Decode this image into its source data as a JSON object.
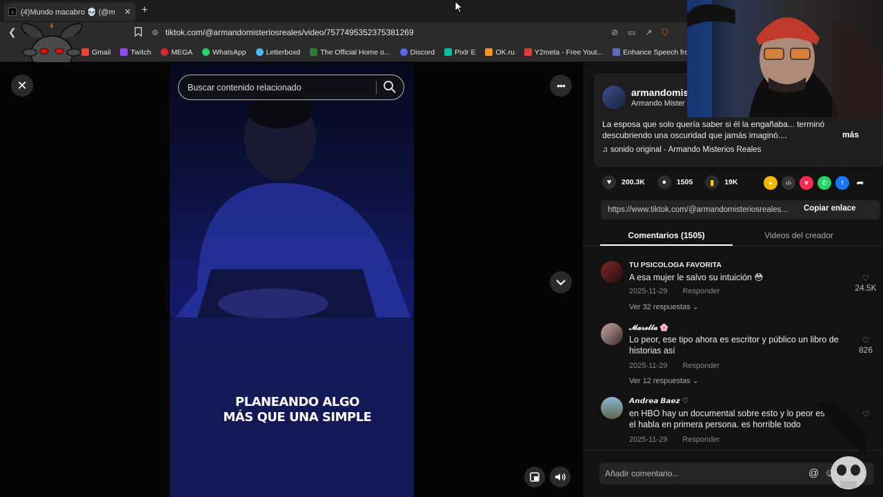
{
  "browser": {
    "tab_title": "(4)Mundo macabro 💀 (@m",
    "tab_close": "✕",
    "new_tab": "+",
    "url": "tiktok.com/@armandomisteriosreales/video/7577495352375381269"
  },
  "bookmarks": [
    {
      "label": "Gmail",
      "color": "#ea4335"
    },
    {
      "label": "Twitch",
      "color": "#9146ff"
    },
    {
      "label": "MEGA",
      "color": "#d9272e"
    },
    {
      "label": "WhatsApp",
      "color": "#25d366"
    },
    {
      "label": "Letterboxd",
      "color": "#40bcf4"
    },
    {
      "label": "The Official Home o...",
      "color": "#2e7d32"
    },
    {
      "label": "Discord",
      "color": "#5865f2"
    },
    {
      "label": "Pixlr E",
      "color": "#00bfa5"
    },
    {
      "label": "OK.ru",
      "color": "#f7931e"
    },
    {
      "label": "Y2meta - Free Yout...",
      "color": "#e53935"
    },
    {
      "label": "Enhance Speech fro...",
      "color": "#5c6bc0"
    }
  ],
  "video": {
    "search_placeholder": "Buscar contenido relacionado",
    "caption_line1": "PLANEANDO ALGO",
    "caption_line2": "MÁS QUE UNA SIMPLE"
  },
  "author": {
    "username": "armandomis",
    "nickname": "Armando Mister",
    "description": "La esposa que solo quería saber si él la engañaba... terminó descubriendo una oscuridad que jamás imaginó....",
    "more": "más",
    "sound": "sonido original - Armando Misterios Reales"
  },
  "stats": {
    "likes": "200.3K",
    "comments": "1505",
    "saves": "19K"
  },
  "share": {
    "link": "https://www.tiktok.com/@armandomisteriosreales...",
    "copy_label": "Copiar enlace"
  },
  "tabs": {
    "comments": "Comentarios (1505)",
    "creator_videos": "Videos del creador"
  },
  "comments": [
    {
      "name": "TU PSICOLOGA FAVORITA",
      "text": "A esa mujer le salvo su intuición 😳",
      "date": "2025-11-29",
      "reply": "Responder",
      "replies": "Ver 32 respuestas ⌄",
      "likes": "24.5K"
    },
    {
      "name": "𝓜𝓪𝓻𝓮𝓵𝓵𝓪 🌸",
      "text": "Lo peor, ese tipo ahora es escritor y público un libro de historias así",
      "date": "2025-11-29",
      "reply": "Responder",
      "replies": "Ver 12 respuestas ⌄",
      "likes": "826"
    },
    {
      "name": "𝘼𝙣𝙙𝙧𝙚𝙖 𝘽𝙖𝙚𝙯 ♡",
      "text": "en HBO hay un documental sobre esto y lo peor es que el habla en primera persona. es horrible todo",
      "date": "2025-11-29",
      "reply": "Responder"
    }
  ],
  "comment_box": {
    "placeholder": "Añadir comentario..."
  }
}
